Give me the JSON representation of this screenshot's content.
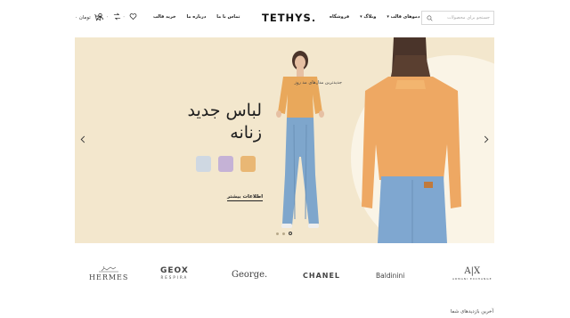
{
  "header": {
    "logo": "TETHYS",
    "cart_total": "۰ تومان",
    "wishlist_count": "۰",
    "compare_count": "۰",
    "nav_left": [
      "خرید قالب",
      "درباره ما",
      "تماس با ما"
    ],
    "nav_right": [
      "دموهای قالب",
      "وبلاگ",
      "فروشگاه"
    ],
    "search_placeholder": "جستجو برای محصولات"
  },
  "hero": {
    "subtitle": "جدیدترین مدل‌های مد روز",
    "title_line1": "لباس جدید",
    "title_line2": "زنانه",
    "link": "اطلاعات بیشتر",
    "swatch_colors": [
      "#e9b774",
      "#c5b2d6",
      "#cfd8e2"
    ],
    "background_color": "#f3e7cd",
    "slides_total": 3,
    "active_slide": 1
  },
  "brands": {
    "hermes": "HERMES",
    "geox": "GEOX",
    "geox_sub": "RESPIRA",
    "george": "George.",
    "chanel": "CHANEL",
    "baldinini": "Baldinini",
    "ax": "A|X",
    "ax_sub": "ARMANI EXCHANGE"
  },
  "recent": "آخرین بازدیدهای شما"
}
